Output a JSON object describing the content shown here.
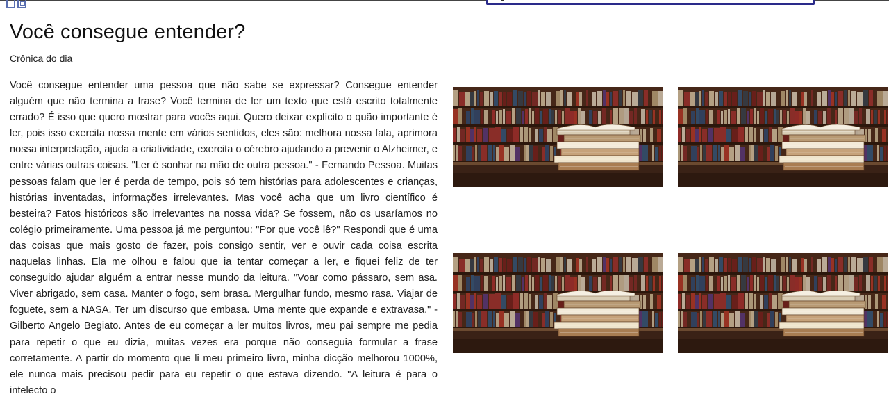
{
  "header": {
    "logo_icon": "logo-icon",
    "search_value": ""
  },
  "article": {
    "title": "Você consegue entender?",
    "subtitle": "Crônica do dia",
    "body": "Você consegue entender uma pessoa que não sabe se expressar? Consegue entender alguém que não termina a frase? Você termina de ler um texto que está escrito totalmente errado? É isso que quero mostrar para vocês aqui. Quero deixar explícito o quão importante é ler, pois isso exercita nossa mente em vários sentidos, eles são: melhora nossa fala, aprimora nossa interpretação, ajuda a criatividade, exercita o cérebro ajudando a prevenir o Alzheimer, e entre várias outras coisas. \"Ler é sonhar na mão de outra pessoa.\" - Fernando Pessoa. Muitas pessoas falam que ler é perda de tempo, pois só tem histórias para adolescentes e crianças, histórias inventadas, informações irrelevantes. Mas você acha que um livro científico é besteira? Fatos históricos são irrelevantes na nossa vida? Se fossem, não os usaríamos no colégio primeiramente. Uma pessoa já me perguntou: \"Por que você lê?\" Respondi que é uma das coisas que mais gosto de fazer, pois consigo sentir, ver e ouvir cada coisa escrita naquelas linhas. Ela me olhou e falou que ia tentar começar a ler, e fiquei feliz de ter conseguido ajudar alguém a entrar nesse mundo da leitura. \"Voar como pássaro, sem asa. Viver abrigado, sem casa. Manter o fogo, sem brasa. Mergulhar fundo, mesmo rasa. Viajar de foguete, sem a NASA. Ter um discurso que embasa. Uma mente que expande e extravasa.\" - Gilberto Angelo Begiato. Antes de eu começar a ler muitos livros, meu pai sempre me pedia para repetir o que eu dizia, muitas vezes era porque não conseguia formular a frase corretamente. A partir do momento que li meu primeiro livro, minha dicção melhorou 1000%, ele nunca mais precisou pedir para eu repetir o que estava dizendo. \"A leitura é para o intelecto o"
  },
  "gallery": {
    "images": [
      {
        "icon": "books-library-image"
      },
      {
        "icon": "books-library-image"
      },
      {
        "icon": "books-library-image"
      },
      {
        "icon": "books-library-image"
      }
    ]
  },
  "colors": {
    "accent": "#2a2a8a",
    "logo": "#5a6fb0",
    "text": "#222222"
  }
}
